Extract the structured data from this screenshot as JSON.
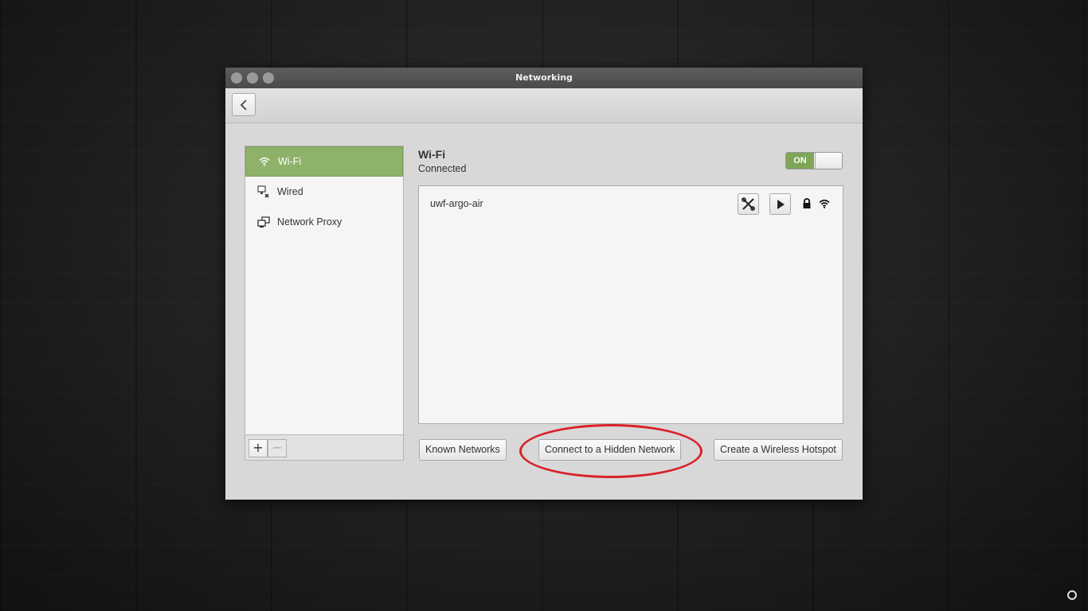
{
  "window": {
    "title": "Networking"
  },
  "toolbar": {
    "back_icon": "chevron-left-icon"
  },
  "sidebar": {
    "items": [
      {
        "label": "Wi-Fi",
        "icon": "wifi-icon",
        "active": true
      },
      {
        "label": "Wired",
        "icon": "wired-disconnected-icon",
        "active": false
      },
      {
        "label": "Network Proxy",
        "icon": "network-proxy-icon",
        "active": false
      }
    ],
    "add_label": "+",
    "remove_label": "−"
  },
  "wifi": {
    "title": "Wi-Fi",
    "status": "Connected",
    "toggle_label": "ON"
  },
  "networks": [
    {
      "name": "uwf-argo-air",
      "secured": true
    }
  ],
  "buttons": {
    "known": "Known Networks",
    "hidden": "Connect to a Hidden Network",
    "hotspot": "Create a Wireless Hotspot"
  },
  "colors": {
    "accent": "#8fb26a",
    "toggle_on": "#7fa658",
    "annotation": "#d8232a"
  }
}
